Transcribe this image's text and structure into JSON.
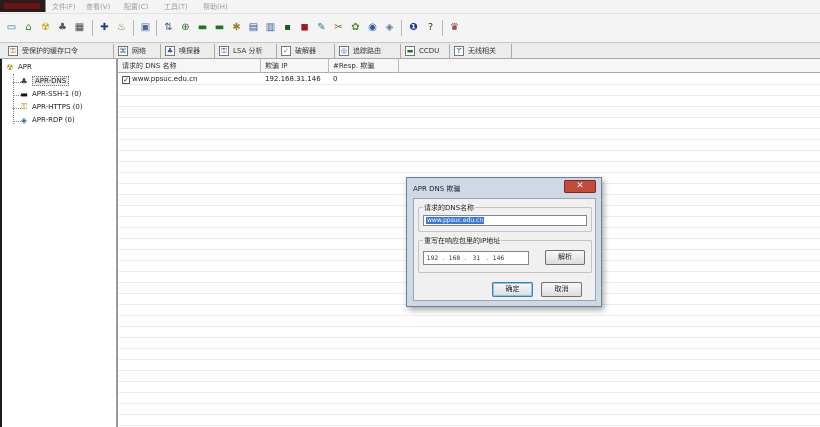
{
  "menu": {
    "items": [
      "文件(F)",
      "查看(V)",
      "配置(C)",
      "工具(T)",
      "帮助(H)"
    ]
  },
  "toolbar": {
    "icons": [
      "folder-icon",
      "network-icon",
      "radiation-icon",
      "sniffer-icon",
      "table-icon",
      "add-icon",
      "delete-icon",
      "decode-icon",
      "route-icon",
      "wordlist-icon",
      "screen-icon",
      "hash-icon",
      "chart-icon",
      "arrows-icon",
      "grid-icon",
      "monitor-icon",
      "book-icon",
      "certificate-icon",
      "key-icon",
      "tools-icon",
      "globe-icon",
      "shield-icon",
      "info-icon",
      "help-icon",
      "caplogo-icon"
    ]
  },
  "tabs": [
    {
      "label": "受保护的缓存口令",
      "icon": "lock-icon"
    },
    {
      "label": "网络",
      "icon": "network-icon"
    },
    {
      "label": "嗅探器",
      "icon": "sniffer-icon"
    },
    {
      "label": "LSA 分析",
      "icon": "lsa-icon"
    },
    {
      "label": "破解器",
      "icon": "cracker-icon"
    },
    {
      "label": "追踪路由",
      "icon": "traceroute-icon"
    },
    {
      "label": "CCDU",
      "icon": "ccdu-icon"
    },
    {
      "label": "无线相关",
      "icon": "wireless-icon"
    }
  ],
  "tree": {
    "root": "APR",
    "children": [
      {
        "label": "APR-DNS",
        "icon": "dns-icon"
      },
      {
        "label": "APR-SSH-1 (0)",
        "icon": "terminal-icon"
      },
      {
        "label": "APR-HTTPS (0)",
        "icon": "lock-icon"
      },
      {
        "label": "APR-RDP (0)",
        "icon": "rdp-icon"
      }
    ]
  },
  "grid": {
    "columns": [
      "请求的 DNS 名称",
      "欺骗 IP",
      "#Resp. 欺骗"
    ],
    "rows": [
      {
        "checked": true,
        "name": "www.ppsuc.edu.cn",
        "ip": "192.168.31.146",
        "resp": "0"
      }
    ]
  },
  "dialog": {
    "title": "APR DNS 欺骗",
    "close_label": "✕",
    "dns_group_label": "请求的DNS名称",
    "dns_value": "www.ppsuc.edu.cn",
    "ip_group_label": "重写在响应包里的IP地址",
    "ip_octets": [
      "192",
      "168",
      "31",
      "146"
    ],
    "resolve_button": "解析",
    "ok_button": "确定",
    "cancel_button": "取消"
  },
  "colors": {
    "dialog_frame": "#cfd9e6",
    "close_button": "#c44a3a",
    "selection": "#3a78d6"
  }
}
